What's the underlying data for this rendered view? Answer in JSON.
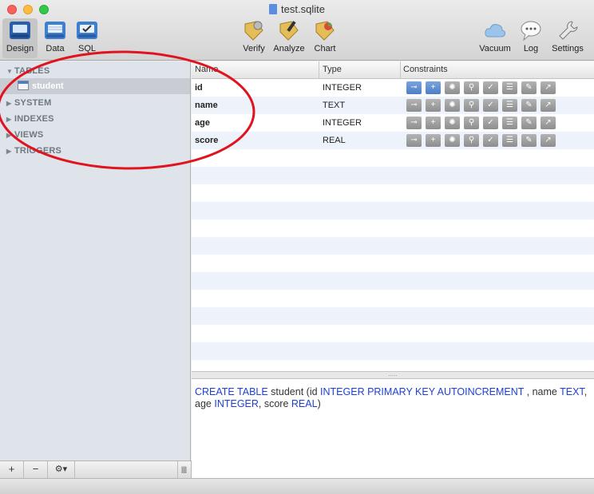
{
  "window": {
    "title": "test.sqlite"
  },
  "toolbar": {
    "left": [
      {
        "label": "Design",
        "icon": "design-icon"
      },
      {
        "label": "Data",
        "icon": "data-icon"
      },
      {
        "label": "SQL",
        "icon": "sql-icon"
      }
    ],
    "center": [
      {
        "label": "Verify",
        "icon": "verify-icon"
      },
      {
        "label": "Analyze",
        "icon": "analyze-icon"
      },
      {
        "label": "Chart",
        "icon": "chart-icon"
      }
    ],
    "right": [
      {
        "label": "Vacuum",
        "icon": "cloud-icon"
      },
      {
        "label": "Log",
        "icon": "speech-bubble-icon"
      },
      {
        "label": "Settings",
        "icon": "wrench-icon"
      }
    ]
  },
  "sidebar": {
    "groups": [
      {
        "label": "TABLES",
        "expanded": true,
        "items": [
          {
            "label": "student",
            "selected": true
          }
        ]
      },
      {
        "label": "SYSTEM",
        "expanded": false
      },
      {
        "label": "INDEXES",
        "expanded": false
      },
      {
        "label": "VIEWS",
        "expanded": false
      },
      {
        "label": "TRIGGERS",
        "expanded": false
      }
    ],
    "footer": {
      "add": "+",
      "remove": "−",
      "gear": "⚙▾",
      "handle": "|||"
    }
  },
  "grid": {
    "headers": {
      "name": "Name",
      "type": "Type",
      "constraints": "Constraints"
    },
    "rows": [
      {
        "name": "id",
        "type": "INTEGER",
        "active": [
          0,
          1
        ]
      },
      {
        "name": "name",
        "type": "TEXT",
        "active": []
      },
      {
        "name": "age",
        "type": "INTEGER",
        "active": []
      },
      {
        "name": "score",
        "type": "REAL",
        "active": []
      }
    ],
    "constraint_icons": [
      "key-icon",
      "plus-icon",
      "sun-icon",
      "pin-icon",
      "check-icon",
      "list-icon",
      "wrench-icon",
      "link-out-icon"
    ]
  },
  "sql": {
    "parts": [
      {
        "t": "CREATE TABLE",
        "kw": true
      },
      {
        "t": " student (id ",
        "kw": false
      },
      {
        "t": "INTEGER PRIMARY KEY AUTOINCREMENT",
        "kw": true
      },
      {
        "t": " , name ",
        "kw": false
      },
      {
        "t": "TEXT",
        "kw": true
      },
      {
        "t": ", age ",
        "kw": false
      },
      {
        "t": "INTEGER",
        "kw": true
      },
      {
        "t": ", score ",
        "kw": false
      },
      {
        "t": "REAL",
        "kw": true
      },
      {
        "t": ")",
        "kw": false
      }
    ]
  },
  "colors": {
    "keyword": "#1d3fd6",
    "annotation": "#e0141e",
    "accent": "#4c7fc6"
  }
}
